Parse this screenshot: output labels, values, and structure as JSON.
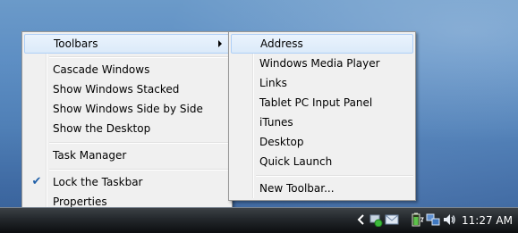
{
  "main_menu": {
    "items": [
      {
        "label": "Toolbars",
        "has_submenu": true,
        "highlighted": true
      },
      {
        "label": "Cascade Windows"
      },
      {
        "label": "Show Windows Stacked"
      },
      {
        "label": "Show Windows Side by Side"
      },
      {
        "label": "Show the Desktop"
      },
      {
        "label": "Task Manager"
      },
      {
        "label": "Lock the Taskbar",
        "checked": true
      },
      {
        "label": "Properties"
      }
    ]
  },
  "toolbars_submenu": {
    "items": [
      {
        "label": "Address",
        "highlighted": true
      },
      {
        "label": "Windows Media Player"
      },
      {
        "label": "Links"
      },
      {
        "label": "Tablet PC Input Panel"
      },
      {
        "label": "iTunes"
      },
      {
        "label": "Desktop"
      },
      {
        "label": "Quick Launch"
      },
      {
        "label": "New Toolbar..."
      }
    ]
  },
  "tray": {
    "icons": [
      "chevron-left-icon",
      "network-status-icon",
      "mail-icon",
      "battery-icon",
      "network-icon",
      "volume-icon"
    ],
    "clock": "11:27 AM"
  },
  "colors": {
    "menu_background": "#f0f0f0",
    "highlight_border": "#aecff7",
    "check_color": "#1f5fa8",
    "taskbar_dark": "#0c0e10"
  }
}
